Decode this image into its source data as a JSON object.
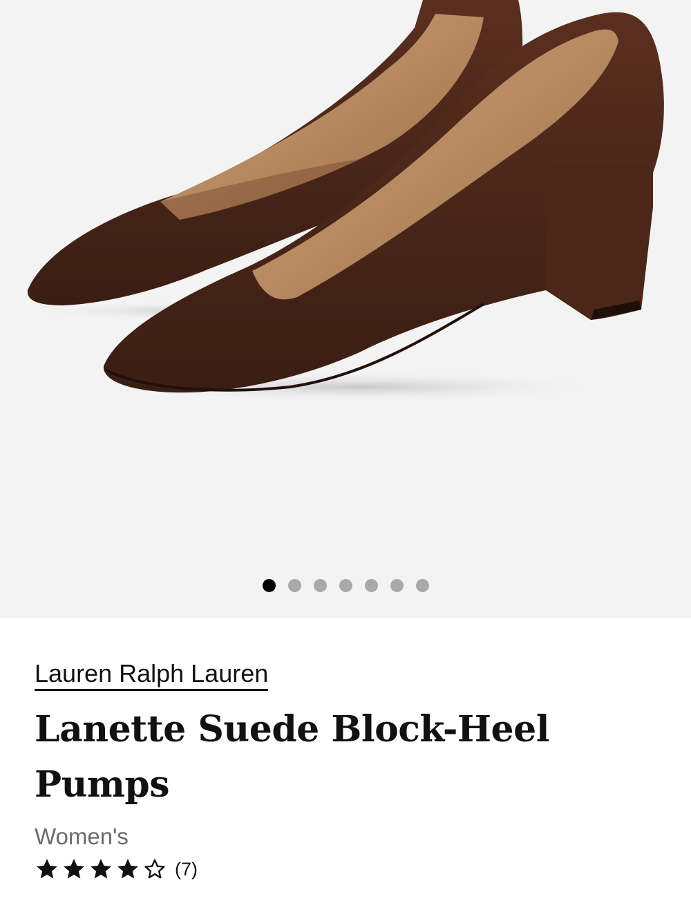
{
  "gallery": {
    "image_alt": "Lanette Suede Block-Heel Pumps",
    "dot_count": 7,
    "active_index": 0
  },
  "product": {
    "brand": "Lauren Ralph Lauren",
    "title_line1": "Lanette Suede Block-Heel",
    "title_line2": "Pumps",
    "gender": "Women's",
    "rating": {
      "value": 4,
      "max": 5,
      "count_text": "(7)"
    }
  },
  "colors": {
    "gallery_bg": "#f3f3f3",
    "suede": "#4a2619",
    "lining": "#b98b62",
    "dot_active": "#000000",
    "dot_inactive": "#a9a9a9"
  }
}
